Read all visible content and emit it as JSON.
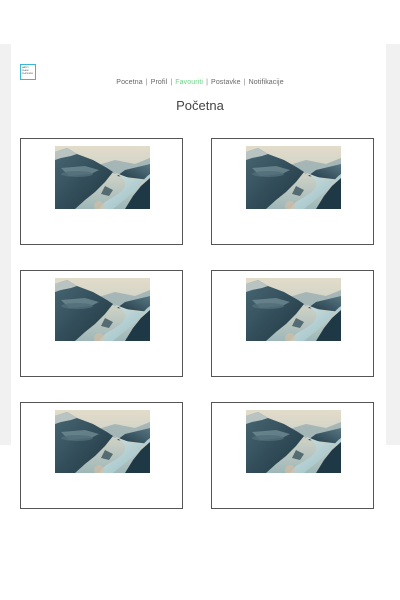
{
  "logo": {
    "lines": [
      "HAPPY",
      "PLACE",
      "PLATFORM"
    ]
  },
  "nav": {
    "items": [
      {
        "label": "Pocetna",
        "active": false
      },
      {
        "label": "Profil",
        "active": false
      },
      {
        "label": "Favouriti",
        "active": true
      },
      {
        "label": "Postavke",
        "active": false
      },
      {
        "label": "Notifikacije",
        "active": false
      }
    ],
    "separator": "|",
    "active_color": "#6fd48b"
  },
  "page": {
    "title": "Početna"
  },
  "cards": [
    {
      "image": "fjord-landscape-photo"
    },
    {
      "image": "fjord-landscape-photo"
    },
    {
      "image": "fjord-landscape-photo"
    },
    {
      "image": "fjord-landscape-photo"
    },
    {
      "image": "fjord-landscape-photo"
    },
    {
      "image": "fjord-landscape-photo"
    }
  ]
}
